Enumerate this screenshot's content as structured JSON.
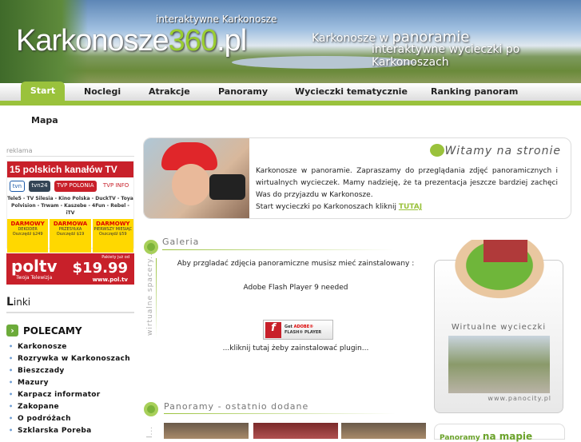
{
  "header": {
    "logo_main": "Karkonosze",
    "logo_num": "360",
    "logo_tld": ".pl",
    "tagline": "interaktywne Karkonosze",
    "slogan_a": "Karkonosze w ",
    "slogan_b": "panoramie",
    "slogan2": "interaktywne wycieczki po Karkonoszach"
  },
  "nav": {
    "items": [
      "Start",
      "Noclegi",
      "Atrakcje",
      "Panoramy",
      "Wycieczki tematycznie",
      "Ranking panoram"
    ],
    "mapa": "Mapa",
    "accent": "#9ac23c"
  },
  "sidebar": {
    "reklama": "reklama",
    "ad1": {
      "title": "15 polskich kanałów TV",
      "logos": [
        "tvn",
        "tvn24",
        "TVP POLONIA",
        "TVP INFO"
      ],
      "channels": "Tele5 - TV Silesia - Kino Polska - DuckTV - Toya Polvision - Trwam - Kaszebe - 4Fun - Rebel - iTV",
      "offers": [
        {
          "t": "DARMOWY",
          "s": "DEKODER",
          "o": "Oszczędź $249"
        },
        {
          "t": "DARMOWA",
          "s": "PRZESYŁKA",
          "o": "Oszczędź $19"
        },
        {
          "t": "DARMOWY",
          "s": "PIERWSZY MIESIĄC",
          "o": "Oszczędź $59"
        }
      ]
    },
    "ad2": {
      "logo": "poltv",
      "sub": "Twoja Telewizja",
      "pakiety": "Pakiety już od",
      "price": "$19.99",
      "url": "www.pol.tv"
    },
    "linki_first": "L",
    "linki_rest": "inki",
    "polecamy": "POLECAMY",
    "links": [
      "Karkonosze",
      "Rozrywka w Karkonoszach",
      "Bieszczady",
      "Mazury",
      "Karpacz informator",
      "Zakopane",
      "O podróżach",
      "Szklarska Poreba"
    ]
  },
  "welcome": {
    "title": "Witamy na stronie",
    "text": "Karkonosze w panoramie. Zapraszamy do przeglądania zdjęć panoramicznych i wirtualnych wycieczek. Mamy nadzieję, że ta prezentacja jeszcze bardziej zachęci Was do przyjazdu w Karkonosze.",
    "start_text": "Start wycieczki po Karkonoszach kliknij ",
    "start_link": "TUTAJ"
  },
  "galeria": {
    "title": "Galeria",
    "vertical": "wirtualne spacery...",
    "msg": "Aby przgladać zdjęcia panoramiczne musisz mieć zainstalowany :",
    "needed": "Adobe Flash Player 9 needed",
    "btn_get": "Get ",
    "btn_adobe": "ADOBE®",
    "btn_flash": "FLASH® PLAYER",
    "install": "...kliknij tutaj żeby zainstalować plugin..."
  },
  "wycieczki": {
    "title": "Wirtualne wycieczki",
    "url": "www.panocity.pl"
  },
  "panoramy": {
    "title": "Panoramy - ostatnio dodane",
    "vertical": "l...",
    "map_a": "Panoramy ",
    "map_b": "na mapie"
  }
}
